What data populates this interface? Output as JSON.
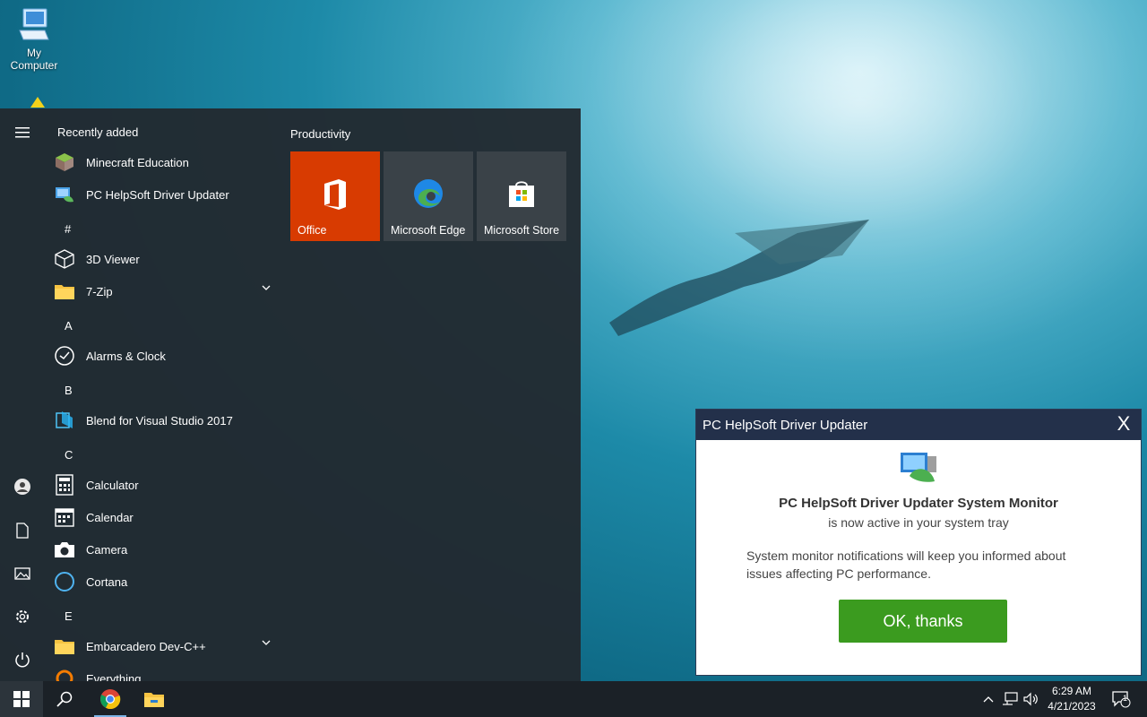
{
  "desktop": {
    "icons": [
      {
        "label_line1": "My",
        "label_line2": "Computer",
        "icon": "computer-icon"
      }
    ]
  },
  "start_menu": {
    "recently_added_header": "Recently added",
    "recent_apps": [
      {
        "label": "Minecraft Education",
        "icon": "minecraft-icon"
      },
      {
        "label": "PC HelpSoft Driver Updater",
        "icon": "driver-updater-icon"
      }
    ],
    "groups": [
      {
        "letter": "#",
        "apps": [
          {
            "label": "3D Viewer",
            "icon": "cube-icon"
          },
          {
            "label": "7-Zip",
            "icon": "folder-icon",
            "expandable": true
          }
        ]
      },
      {
        "letter": "A",
        "apps": [
          {
            "label": "Alarms & Clock",
            "icon": "clock-icon"
          }
        ]
      },
      {
        "letter": "B",
        "apps": [
          {
            "label": "Blend for Visual Studio 2017",
            "icon": "blend-icon"
          }
        ]
      },
      {
        "letter": "C",
        "apps": [
          {
            "label": "Calculator",
            "icon": "calculator-icon"
          },
          {
            "label": "Calendar",
            "icon": "calendar-icon"
          },
          {
            "label": "Camera",
            "icon": "camera-icon"
          },
          {
            "label": "Cortana",
            "icon": "cortana-icon"
          }
        ]
      },
      {
        "letter": "E",
        "apps": [
          {
            "label": "Embarcadero Dev-C++",
            "icon": "folder-icon",
            "expandable": true
          },
          {
            "label": "Everything",
            "icon": "everything-icon"
          }
        ]
      }
    ],
    "tiles_header": "Productivity",
    "tiles": [
      {
        "label": "Office",
        "icon": "office-icon",
        "color": "#d83b01"
      },
      {
        "label": "Microsoft Edge",
        "icon": "edge-icon",
        "color": "#3a4248"
      },
      {
        "label": "Microsoft Store",
        "icon": "store-icon",
        "color": "#3a4248"
      }
    ],
    "rail": [
      "hamburger-icon",
      "user-icon",
      "document-icon",
      "pictures-icon",
      "settings-icon",
      "power-icon"
    ]
  },
  "notification": {
    "title": "PC HelpSoft Driver Updater",
    "close": "X",
    "heading": "PC HelpSoft Driver Updater System Monitor",
    "subheading": "is now active in your system tray",
    "description": "System monitor notifications will keep you informed about issues affecting PC performance.",
    "button": "OK, thanks"
  },
  "taskbar": {
    "apps": [
      "windows-start-icon",
      "search-icon",
      "chrome-icon",
      "file-explorer-icon"
    ],
    "tray_icons": [
      "chevron-up-icon",
      "network-icon",
      "volume-icon"
    ],
    "time": "6:29 AM",
    "date": "4/21/2023",
    "notification_count": "1"
  },
  "colors": {
    "start_bg": "#222a30",
    "taskbar_bg": "#1b2127",
    "office_tile": "#d83b01",
    "ok_button": "#3b9b1f",
    "notif_titlebar": "#23304a"
  }
}
